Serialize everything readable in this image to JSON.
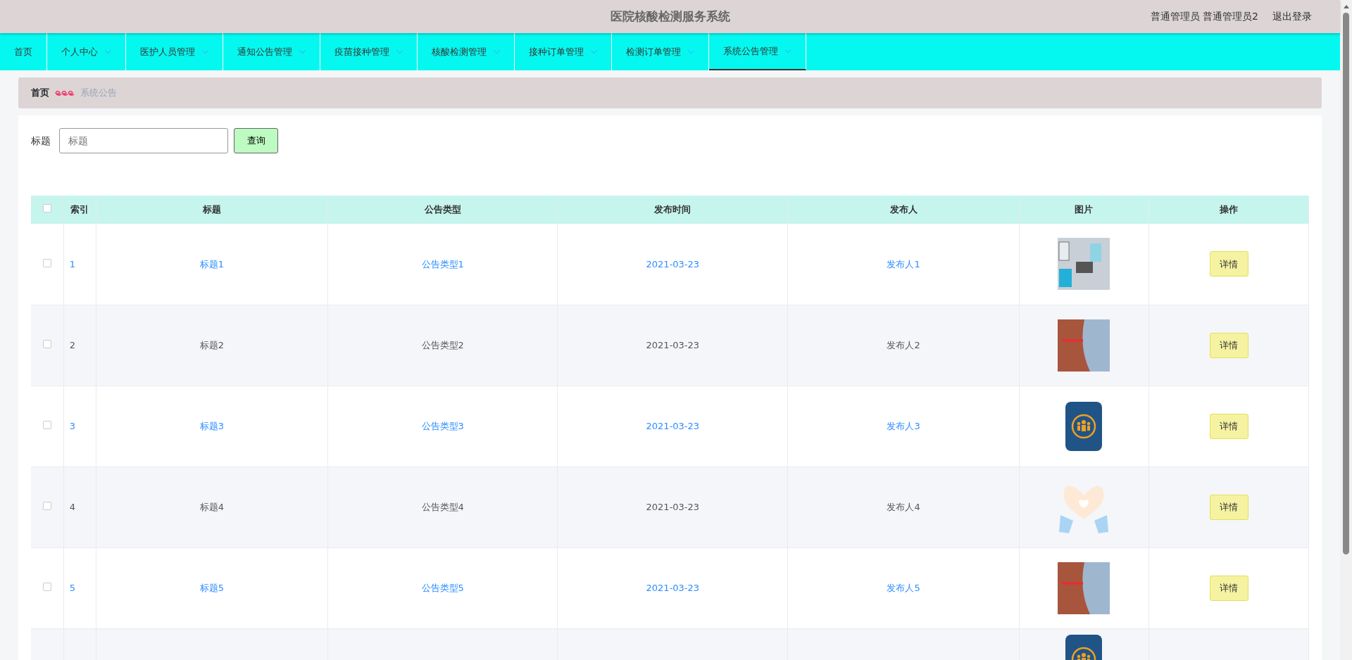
{
  "header": {
    "title": "医院核酸检测服务系统",
    "role": "普通管理员",
    "user": "普通管理员2",
    "logout": "退出登录"
  },
  "nav": [
    {
      "label": "首页",
      "dropdown": false,
      "selected": false
    },
    {
      "label": "个人中心",
      "dropdown": true,
      "selected": false
    },
    {
      "label": "医护人员管理",
      "dropdown": true,
      "selected": false
    },
    {
      "label": "通知公告管理",
      "dropdown": true,
      "selected": false
    },
    {
      "label": "疫苗接种管理",
      "dropdown": true,
      "selected": false
    },
    {
      "label": "核酸检测管理",
      "dropdown": true,
      "selected": false
    },
    {
      "label": "接种订单管理",
      "dropdown": true,
      "selected": false
    },
    {
      "label": "检测订单管理",
      "dropdown": true,
      "selected": false
    },
    {
      "label": "系统公告管理",
      "dropdown": true,
      "selected": true
    }
  ],
  "breadcrumb": {
    "home": "首页",
    "current": "系统公告"
  },
  "search": {
    "label": "标题",
    "placeholder": "标题",
    "button": "查询"
  },
  "table": {
    "columns": [
      "索引",
      "标题",
      "公告类型",
      "发布时间",
      "发布人",
      "图片",
      "操作"
    ],
    "rows": [
      {
        "index": "1",
        "title": "标题1",
        "type": "公告类型1",
        "time": "2021-03-23",
        "publisher": "发布人1",
        "image": {
          "kind": "photo"
        },
        "action": "详情",
        "highlighted": true,
        "checked": false
      },
      {
        "index": "2",
        "title": "标题2",
        "type": "公告类型2",
        "time": "2021-03-23",
        "publisher": "发布人2",
        "image": {
          "kind": "photo"
        },
        "action": "详情",
        "highlighted": false,
        "checked": false
      },
      {
        "index": "3",
        "title": "标题3",
        "type": "公告类型3",
        "time": "2021-03-23",
        "publisher": "发布人3",
        "image": {
          "kind": "logo"
        },
        "action": "详情",
        "highlighted": true,
        "checked": false
      },
      {
        "index": "4",
        "title": "标题4",
        "type": "公告类型4",
        "time": "2021-03-23",
        "publisher": "发布人4",
        "image": {
          "kind": "drawing"
        },
        "action": "详情",
        "highlighted": false,
        "checked": false
      },
      {
        "index": "5",
        "title": "标题5",
        "type": "公告类型5",
        "time": "2021-03-23",
        "publisher": "发布人5",
        "image": {
          "kind": "photo"
        },
        "action": "详情",
        "highlighted": true,
        "checked": false
      }
    ],
    "cut_row": {
      "image": {
        "kind": "logo"
      }
    },
    "all_checked": false
  }
}
